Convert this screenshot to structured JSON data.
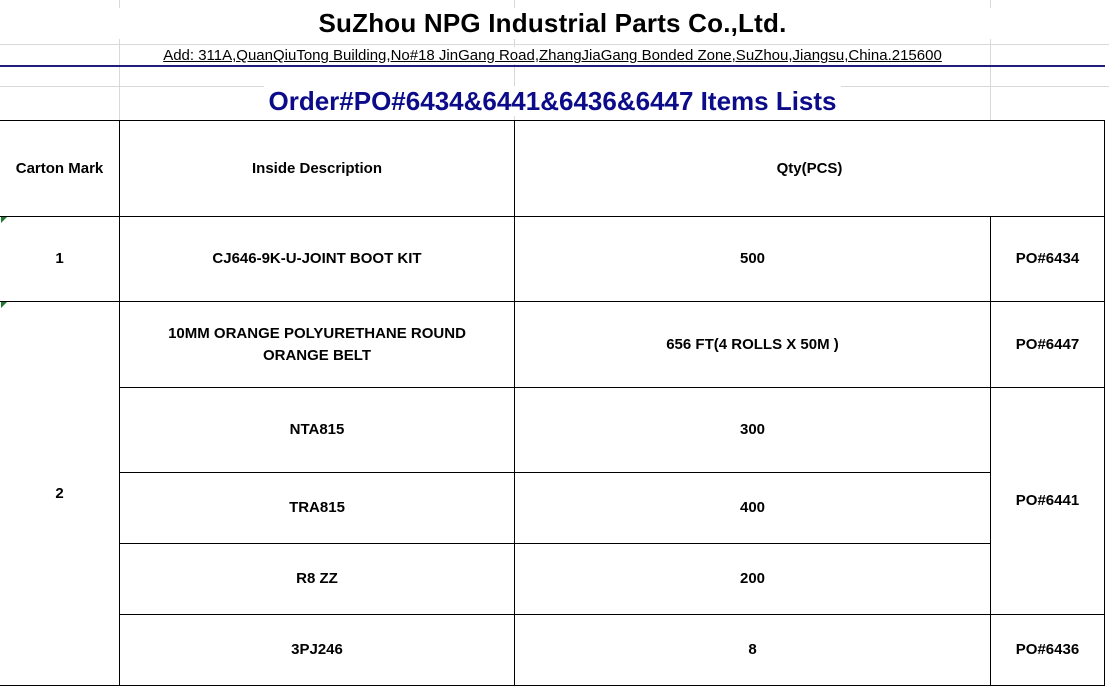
{
  "header": {
    "company_name": "SuZhou NPG Industrial Parts Co.,Ltd.",
    "address": "Add: 311A,QuanQiuTong Building,No#18 JinGang Road,ZhangJiaGang Bonded Zone,SuZhou,Jiangsu,China.215600",
    "order_title": "Order#PO#6434&6441&6436&6447 Items Lists"
  },
  "table": {
    "columns": {
      "carton_mark": "Carton Mark",
      "inside_description": "Inside Description",
      "qty": "Qty(PCS)"
    },
    "cartons": [
      {
        "mark": "1"
      },
      {
        "mark": "2"
      }
    ],
    "rows": [
      {
        "description": "CJ646-9K-U-JOINT BOOT KIT",
        "qty": "500"
      },
      {
        "description": "10MM ORANGE POLYURETHANE ROUND ORANGE BELT",
        "qty": "656 FT(4 ROLLS X 50M )"
      },
      {
        "description": "NTA815",
        "qty": "300"
      },
      {
        "description": "TRA815",
        "qty": "400"
      },
      {
        "description": "R8 ZZ",
        "qty": "200"
      },
      {
        "description": "3PJ246",
        "qty": "8"
      }
    ],
    "po_groups": [
      {
        "po": "PO#6434"
      },
      {
        "po": "PO#6447"
      },
      {
        "po": "PO#6441"
      },
      {
        "po": "PO#6436"
      }
    ]
  },
  "colors": {
    "title_blue": "#0c0c8a",
    "rule_navy": "#1f1f7a",
    "grid_gray": "#d9d9d9",
    "comment_marker_green": "#1e7a2e"
  }
}
